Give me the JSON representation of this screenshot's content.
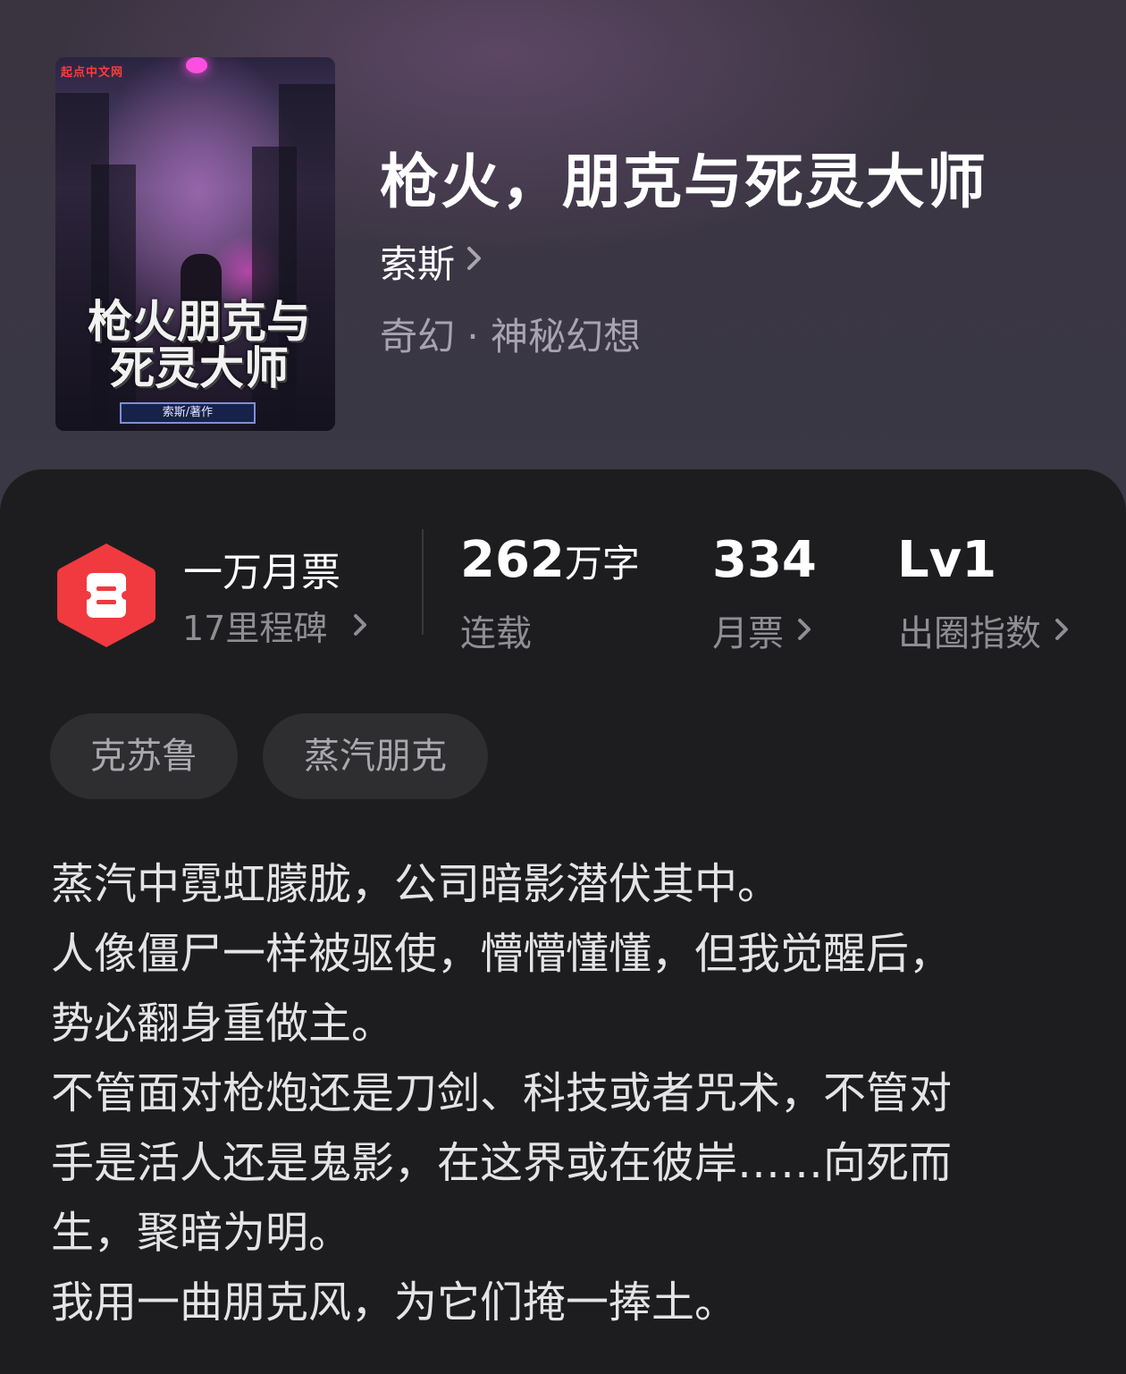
{
  "book": {
    "title": "枪火，朋克与死灵大师",
    "author": "索斯",
    "genre": "奇幻 · 神秘幻想"
  },
  "cover": {
    "brand": "起点中文网",
    "title_line1": "枪火朋克与",
    "title_line2": "死灵大师",
    "author_tag": "索斯/著作"
  },
  "stats": {
    "monthly_ticket_badge": {
      "title": "一万月票",
      "subtitle": "17里程碑"
    },
    "word_count": {
      "value": "262",
      "unit": "万字",
      "label": "连载"
    },
    "monthly_tickets": {
      "value": "334",
      "label": "月票"
    },
    "popularity": {
      "value": "Lv1",
      "label": "出圈指数"
    }
  },
  "tags": [
    "克苏鲁",
    "蒸汽朋克"
  ],
  "description": "蒸汽中霓虹朦胧，公司暗影潜伏其中。\n人像僵尸一样被驱使，懵懵懂懂，但我觉醒后，\n势必翻身重做主。\n不管面对枪炮还是刀剑、科技或者咒术，不管对\n手是活人还是鬼影，在这界或在彼岸……向死而\n生，聚暗为明。\n我用一曲朋克风，为它们掩一捧土。",
  "colors": {
    "badge_red": "#f03a3f",
    "panel_bg": "#1d1d20",
    "muted_text": "#8e8e93"
  },
  "icons": {
    "badge": "ticket-badge-icon",
    "chevron": "chevron-right-icon"
  }
}
